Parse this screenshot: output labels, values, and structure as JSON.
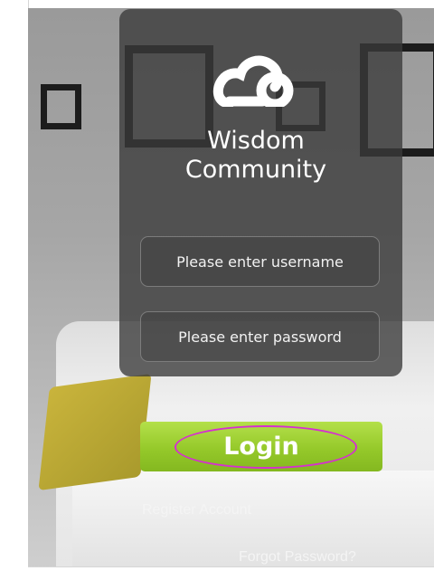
{
  "app": {
    "title": "Wisdom Community",
    "logo_icon": "cloud-icon"
  },
  "login_form": {
    "username": {
      "value": "",
      "placeholder": "Please enter username"
    },
    "password": {
      "value": "",
      "placeholder": "Please enter password"
    },
    "login_label": "Login"
  },
  "links": {
    "register": "Register Account",
    "forgot": "Forgot Password?"
  },
  "colors": {
    "accent": "#95c92a",
    "highlight_ring": "#d62fd0",
    "panel": "#3a3a3a"
  }
}
